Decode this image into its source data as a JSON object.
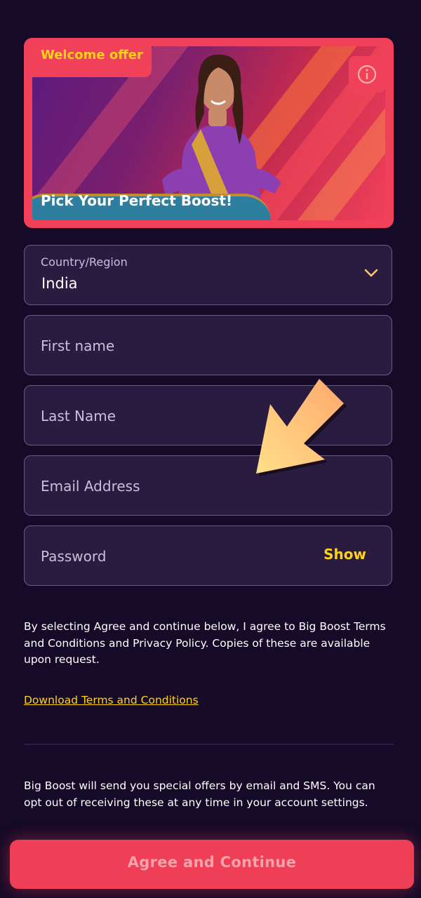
{
  "banner": {
    "badge": "Welcome offer",
    "title": "Pick Your Perfect Boost!",
    "info_icon": "info-icon"
  },
  "form": {
    "country": {
      "label": "Country/Region",
      "value": "India",
      "icon": "chevron-down-icon"
    },
    "first_name": {
      "placeholder": "First name"
    },
    "last_name": {
      "placeholder": "Last Name"
    },
    "email": {
      "placeholder": "Email Address"
    },
    "password": {
      "placeholder": "Password",
      "show_label": "Show"
    }
  },
  "annotation": {
    "icon": "arrow-pointer-icon",
    "color": "#ffc66b"
  },
  "legal": {
    "terms_text": "By selecting Agree and continue below, I agree to Big Boost Terms and Conditions and Privacy Policy. Copies of these are available upon request.",
    "download_link": "Download Terms and Conditions",
    "offers_text": "Big Boost will send you special offers by email and SMS. You can opt out of receiving these at any time in your account settings."
  },
  "cta": {
    "label": "Agree and Continue"
  },
  "colors": {
    "background": "#150a27",
    "accent": "#f0405a",
    "highlight": "#ffd21a",
    "field_bg": "#2a1b41"
  }
}
